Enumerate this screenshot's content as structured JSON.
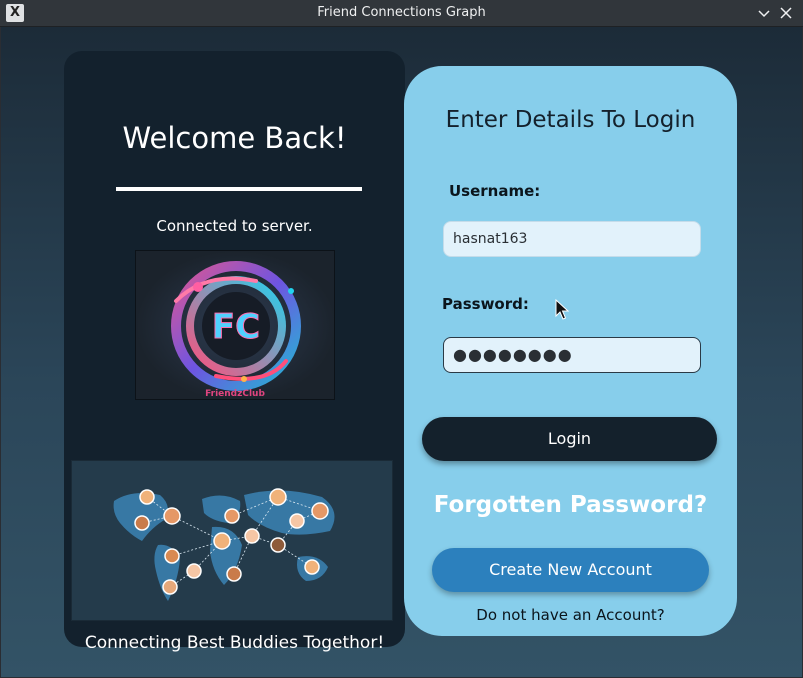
{
  "window": {
    "title": "Friend Connections Graph",
    "app_icon_glyph": "X"
  },
  "left_panel": {
    "welcome": "Welcome Back!",
    "status": "Connected to server.",
    "logo_caption": "FriendzClub",
    "logo_letters": "FC",
    "tagline": "Connecting Best Buddies Togethor!"
  },
  "login": {
    "heading": "Enter Details To Login",
    "username_label": "Username:",
    "username_value": "hasnat163",
    "password_label": "Password:",
    "password_value": "●●●●●●●●",
    "login_button": "Login",
    "forgot_password": "Forgotten Password?",
    "create_account_button": "Create New Account",
    "no_account_text": "Do not have an Account?"
  },
  "colors": {
    "left_panel_bg": "#13212d",
    "right_panel_bg": "#87ceeb",
    "login_button_bg": "#14212c",
    "create_button_bg": "#2c80bd"
  },
  "icons": {
    "app": "x-window-icon",
    "minimize": "chevron-down-icon",
    "close": "close-icon",
    "cursor": "mouse-pointer-icon"
  }
}
